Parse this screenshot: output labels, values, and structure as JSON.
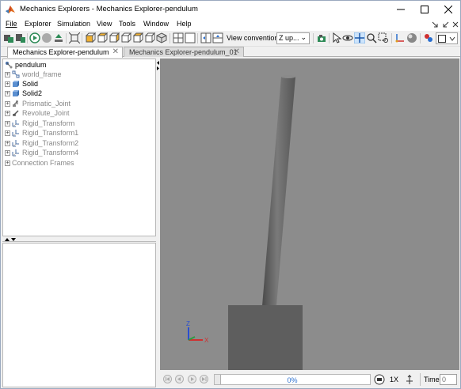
{
  "window": {
    "title": "Mechanics Explorers - Mechanics Explorer-pendulum",
    "minimize": "—",
    "maximize": "☐",
    "close": "✕"
  },
  "menu": {
    "items": [
      "File",
      "Explorer",
      "Simulation",
      "View",
      "Tools",
      "Window",
      "Help"
    ],
    "underline_first": true
  },
  "toolbar": {
    "view_convention_label": "View convention:",
    "view_convention_value": "Z up...",
    "view_convention_arrow": "⌄"
  },
  "tabs": [
    {
      "label": "Mechanics Explorer-pendulum",
      "active": true,
      "close": "✕"
    },
    {
      "label": "Mechanics Explorer-pendulum_01",
      "active": false,
      "close": "✕"
    }
  ],
  "tree": {
    "root": "pendulum",
    "items": [
      {
        "label": "world_frame",
        "style": "dim",
        "icon": "frame-icon"
      },
      {
        "label": "Solid",
        "style": "bold",
        "icon": "solid-icon"
      },
      {
        "label": "Solid2",
        "style": "bold",
        "icon": "solid-icon"
      },
      {
        "label": "Prismatic_Joint",
        "style": "dim",
        "icon": "joint-icon"
      },
      {
        "label": "Revolute_Joint",
        "style": "dim",
        "icon": "joint-icon"
      },
      {
        "label": "Rigid_Transform",
        "style": "dim",
        "icon": "transform-icon"
      },
      {
        "label": "Rigid_Transform1",
        "style": "dim",
        "icon": "transform-icon"
      },
      {
        "label": "Rigid_Transform2",
        "style": "dim",
        "icon": "transform-icon"
      },
      {
        "label": "Rigid_Transform4",
        "style": "dim",
        "icon": "transform-icon"
      },
      {
        "label": "Connection Frames",
        "style": "dim",
        "icon": ""
      }
    ]
  },
  "viewport": {
    "background": "#8c8c8c",
    "axis_z": "Z",
    "axis_x": "X"
  },
  "playback": {
    "progress_text": "0%",
    "progress_fraction": 0,
    "speed": "1X",
    "time_label": "Time",
    "time_value": "0"
  }
}
